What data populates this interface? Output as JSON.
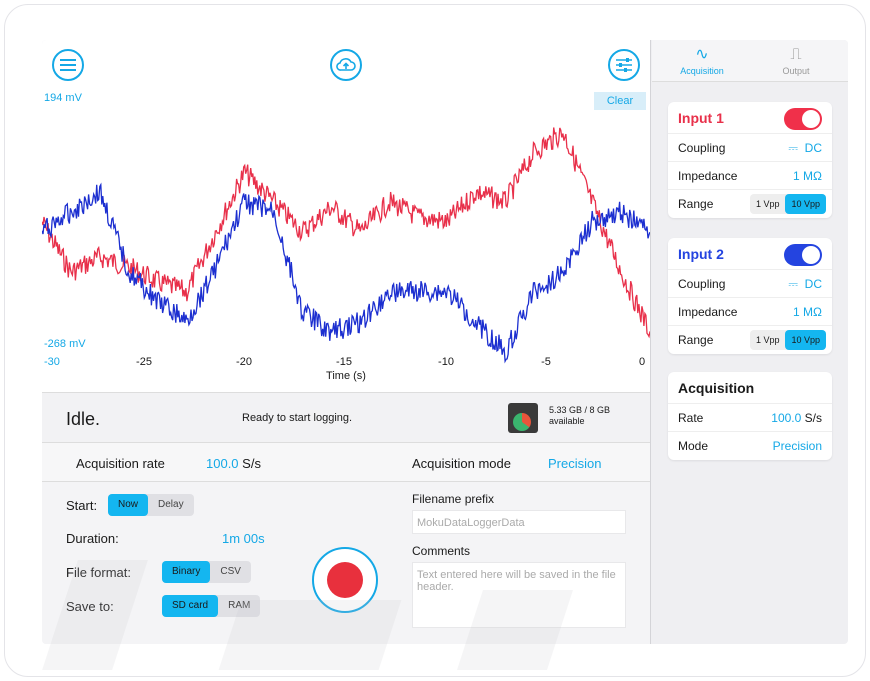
{
  "topbar": {
    "menu_icon": "menu-icon",
    "cloud_icon": "cloud-upload-icon",
    "settings_icon": "sliders-icon"
  },
  "plot": {
    "y_max_label": "194 mV",
    "y_min_label": "-268 mV",
    "clear_label": "Clear",
    "x_ticks": [
      "-30",
      "-25",
      "-20",
      "-15",
      "-10",
      "-5",
      "0"
    ],
    "x_label": "Time (s)",
    "series_colors": {
      "input1": "#e8304a",
      "input2": "#1c2fd0"
    }
  },
  "status": {
    "state": "Idle.",
    "message": "Ready to start logging.",
    "storage_line1": "5.33 GB / 8 GB",
    "storage_line2": "available"
  },
  "rate_row": {
    "acq_rate_label": "Acquisition rate",
    "acq_rate_value": "100.0",
    "acq_rate_unit": "S/s",
    "acq_mode_label": "Acquisition mode",
    "acq_mode_value": "Precision"
  },
  "controls": {
    "start_label": "Start:",
    "start_now": "Now",
    "start_delay": "Delay",
    "duration_label": "Duration:",
    "duration_value": "1m 00s",
    "file_format_label": "File format:",
    "format_binary": "Binary",
    "format_csv": "CSV",
    "save_to_label": "Save to:",
    "save_sd": "SD card",
    "save_ram": "RAM",
    "filename_label": "Filename prefix",
    "filename_placeholder": "MokuDataLoggerData",
    "comments_label": "Comments",
    "comments_placeholder": "Text entered here will be saved in the file header."
  },
  "tabs": {
    "acquisition": "Acquisition",
    "output": "Output"
  },
  "input1": {
    "title": "Input 1",
    "coupling_label": "Coupling",
    "coupling_value": "DC",
    "impedance_label": "Impedance",
    "impedance_value": "1 MΩ",
    "range_label": "Range",
    "range_1": "1 Vpp",
    "range_10": "10 Vpp",
    "toggle_color": "#f0304a"
  },
  "input2": {
    "title": "Input 2",
    "coupling_label": "Coupling",
    "coupling_value": "DC",
    "impedance_label": "Impedance",
    "impedance_value": "1 MΩ",
    "range_label": "Range",
    "range_1": "1 Vpp",
    "range_10": "10 Vpp",
    "toggle_color": "#2444e0"
  },
  "acquisition_card": {
    "title": "Acquisition",
    "rate_label": "Rate",
    "rate_value": "100.0",
    "rate_unit": "S/s",
    "mode_label": "Mode",
    "mode_value": "Precision"
  }
}
